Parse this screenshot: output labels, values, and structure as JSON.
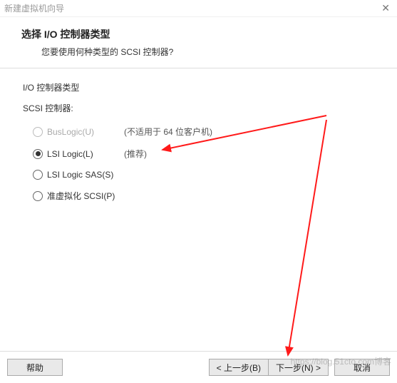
{
  "window": {
    "title": "新建虚拟机向导"
  },
  "header": {
    "title": "选择 I/O 控制器类型",
    "subtitle": "您要使用何种类型的 SCSI 控制器?"
  },
  "group": {
    "label": "I/O 控制器类型",
    "subgroup_label": "SCSI 控制器:"
  },
  "options": [
    {
      "label": "BusLogic(U)",
      "hint": "(不适用于 64 位客户机)",
      "checked": false,
      "disabled": true
    },
    {
      "label": "LSI Logic(L)",
      "hint": "(推荐)",
      "checked": true,
      "disabled": false
    },
    {
      "label": "LSI Logic SAS(S)",
      "hint": "",
      "checked": false,
      "disabled": false
    },
    {
      "label": "准虚拟化 SCSI(P)",
      "hint": "",
      "checked": false,
      "disabled": false
    }
  ],
  "footer": {
    "help": "帮助",
    "back": "< 上一步(B)",
    "next": "下一步(N) >",
    "cancel": "取消"
  },
  "watermark": "https://blog.51cto.com博客"
}
